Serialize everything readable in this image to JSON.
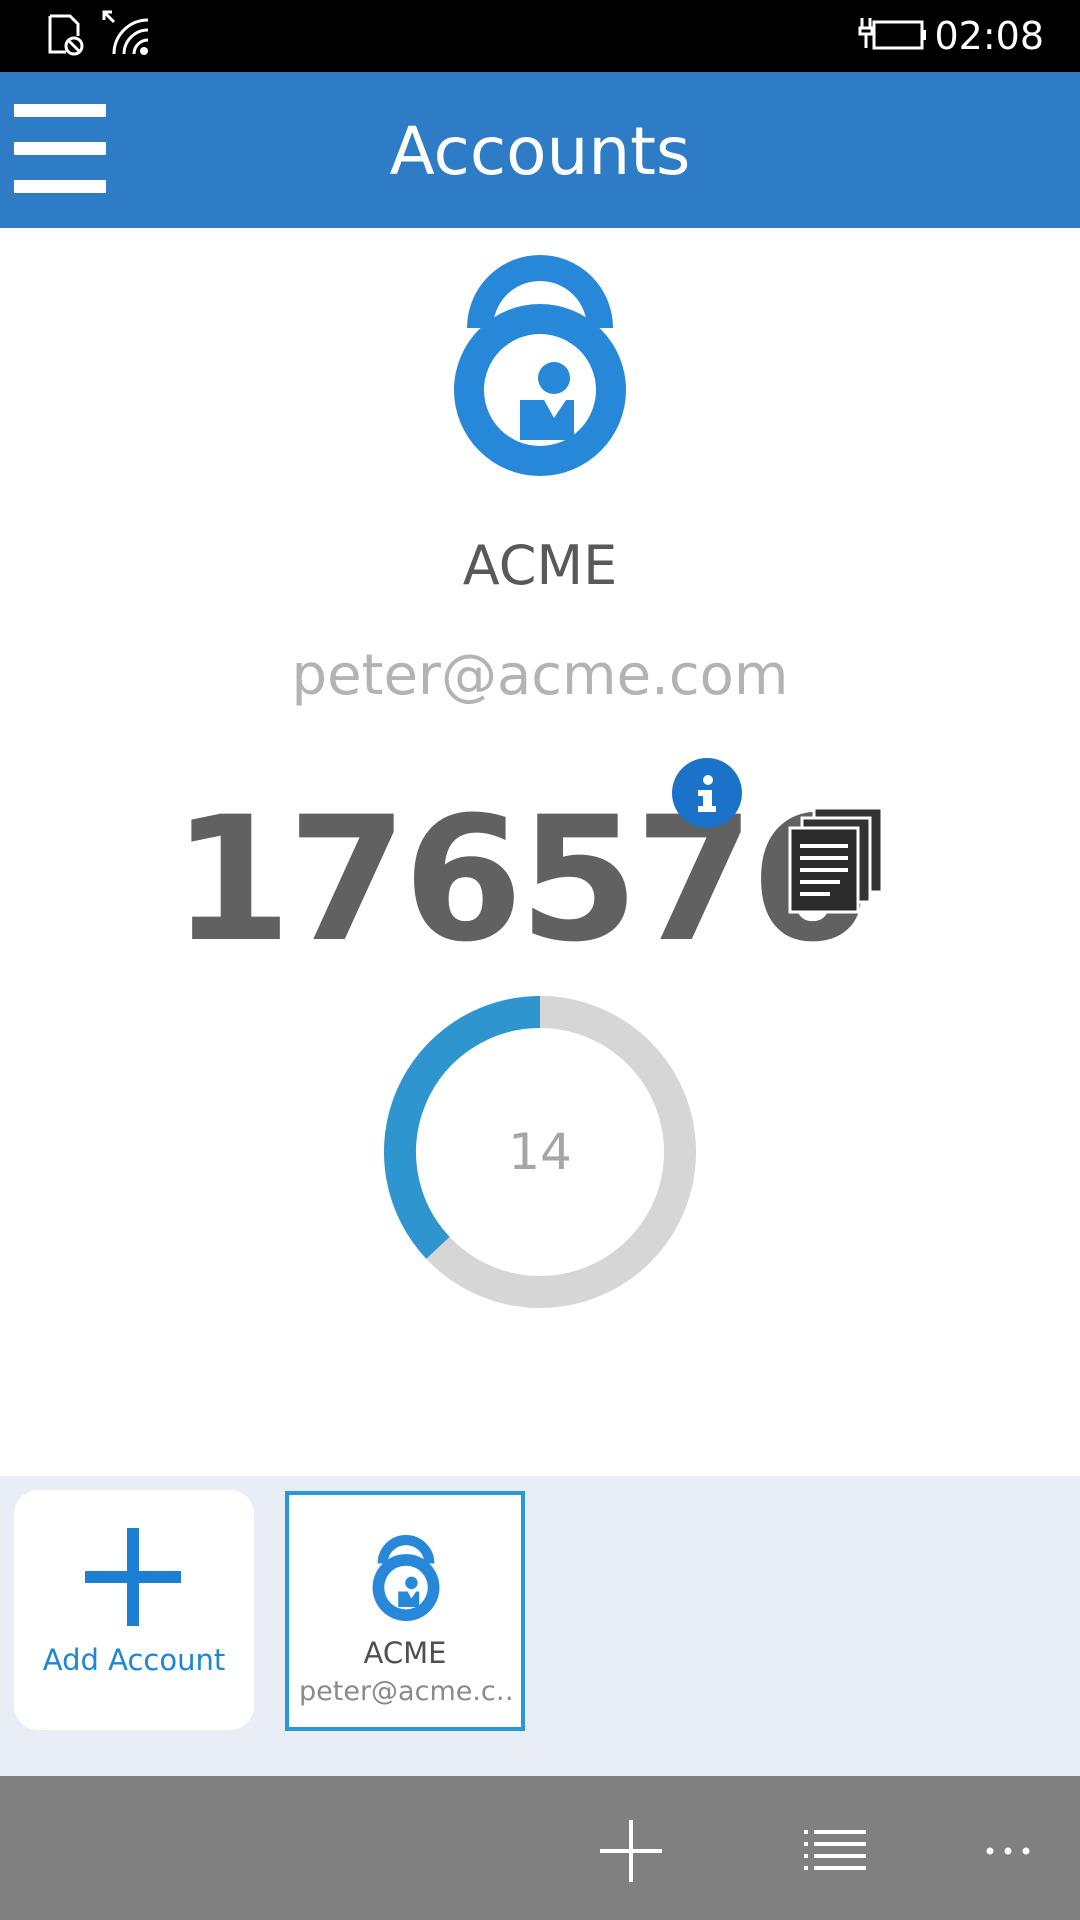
{
  "status_bar": {
    "time": "02:08",
    "icons": [
      "no-sim-icon",
      "wifi-icon",
      "battery-charging-icon"
    ]
  },
  "header": {
    "title": "Accounts",
    "menu_icon": "hamburger-icon",
    "color": "#2e7cc6"
  },
  "account": {
    "name": "ACME",
    "email": "peter@acme.com",
    "code": "176576",
    "seconds_remaining": "14",
    "progress_fraction": 0.37,
    "logo_icon": "padlock-user-icon",
    "info_icon": "info-icon",
    "copy_icon": "copy-icon",
    "accent_color": "#2f95cf"
  },
  "tiles": {
    "add_label": "Add Account",
    "items": [
      {
        "name": "ACME",
        "email": "peter@acme.c…",
        "icon": "padlock-user-icon",
        "selected": true
      }
    ]
  },
  "app_bar": {
    "buttons": [
      "add-icon",
      "list-icon",
      "more-icon"
    ]
  }
}
